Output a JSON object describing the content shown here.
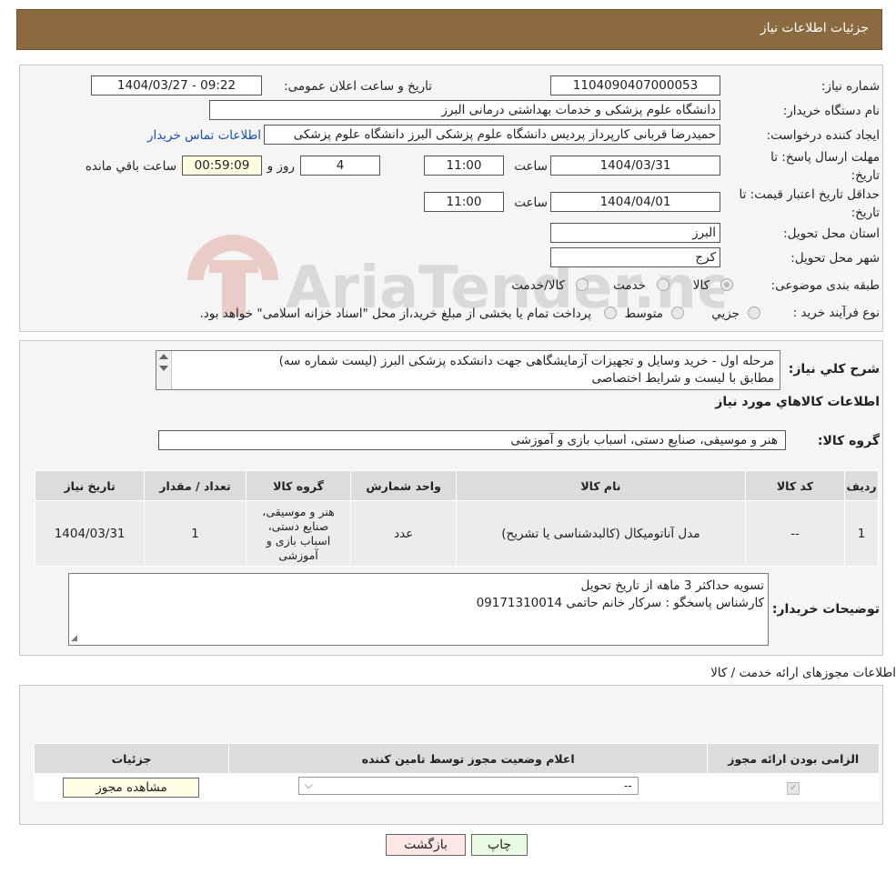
{
  "header": {
    "title": "جزئیات اطلاعات نیاز"
  },
  "watermark": {
    "text": "AriaTender.neT"
  },
  "form": {
    "need_number_label": "شماره نیاز:",
    "need_number": "1104090407000053",
    "announce_label": "تاریخ و ساعت اعلان عمومی:",
    "announce_value": "1404/03/27 - 09:22",
    "buyer_label": "نام دستگاه خریدار:",
    "buyer_value": "دانشگاه علوم پزشکی و خدمات بهداشتی  درمانی البرز",
    "creator_label": "ایجاد کننده درخواست:",
    "creator_value": "حمیدرضا قربانی کارپرداز پردیس دانشگاه علوم پزشکی البرز دانشگاه علوم پزشکی",
    "contact_link": "اطلاعات تماس خریدار",
    "deadline_label": "مهلت ارسال پاسخ: تا تاریخ:",
    "deadline_date": "1404/03/31",
    "time_label": "ساعت",
    "deadline_time": "11:00",
    "days_value": "4",
    "days_label": "روز و",
    "remaining_time": "00:59:09",
    "remaining_label": "ساعت باقي مانده",
    "validity_label": "حداقل تاریخ اعتبار قیمت: تا تاریخ:",
    "validity_date": "1404/04/01",
    "validity_time": "11:00",
    "province_label": "استان محل تحویل:",
    "province_value": "البرز",
    "city_label": "شهر محل تحویل:",
    "city_value": "کرج",
    "category_label": "طبقه بندی موضوعی:",
    "category_options": [
      "کالا",
      "خدمت",
      "کالا/خدمت"
    ],
    "process_label": "نوع فرآیند خرید :",
    "process_options": [
      "جزیي",
      "متوسط"
    ],
    "process_note": "پرداخت تمام یا بخشی از مبلغ خرید،از محل \"اسناد خزانه اسلامی\" خواهد بود."
  },
  "summary": {
    "title_label": "شرح کلي نياز:",
    "description_line1": "مرحله اول - خرید وسایل و تجهیزات آزمایشگاهی جهت دانشکده پزشکی البرز (لیست شماره سه)",
    "description_line2": "مطابق با لیست و شرایط اختصاصی",
    "goods_section_title": "اطلاعات کالاهاي مورد نياز",
    "goods_group_label": "گروه کالا:",
    "goods_group_value": "هنر و موسیقی، صنایع دستی، اسباب بازی و آموزشی",
    "table_headers": [
      "ردیف",
      "کد کالا",
      "نام کالا",
      "واحد شمارش",
      "گروه کالا",
      "تعداد / مقدار",
      "تاریخ نیاز"
    ],
    "rows": [
      {
        "row": "1",
        "code": "--",
        "name": "مدل آناتومیکال (کالبدشناسی یا تشریح)",
        "unit": "عدد",
        "group_l1": "هنر و موسیقی،",
        "group_l2": "صنایع دستی،",
        "group_l3": "اسباب بازی و",
        "group_l4": "آموزشی",
        "qty": "1",
        "date": "1404/03/31"
      }
    ],
    "buyer_notes_label": "توضیحات خریدار:",
    "buyer_notes_line1": "تسویه حداکثر 3 ماهه از تاریخ تحویل",
    "buyer_notes_line2": "کارشناس پاسخگو : سرکار خانم حاتمی  09171310014"
  },
  "permits": {
    "title": "اطلاعات مجوزهای ارائه خدمت / کالا",
    "headers": [
      "الزامی بودن ارائه مجوز",
      "اعلام وضعیت مجوز توسط تامین کننده",
      "جزئیات"
    ],
    "select_value": "--",
    "view_button": "مشاهده مجوز"
  },
  "actions": {
    "print": "چاپ",
    "back": "بازگشت"
  }
}
